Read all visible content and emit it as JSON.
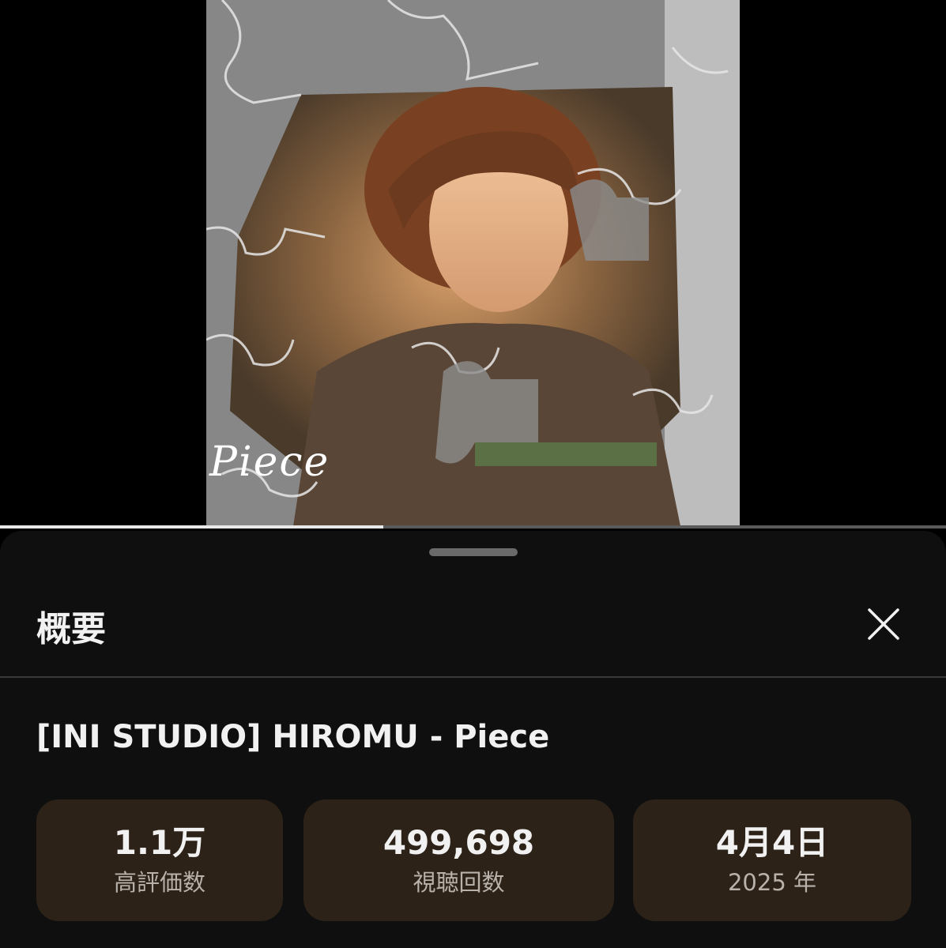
{
  "player": {
    "thumbnail_text": "Piece",
    "progress_fraction": 0.405
  },
  "sheet": {
    "title": "概要",
    "close_icon": "close-icon"
  },
  "video": {
    "title": "[INI STUDIO] HIROMU - Piece"
  },
  "stats": [
    {
      "value": "1.1万",
      "label": "高評価数"
    },
    {
      "value": "499,698",
      "label": "視聴回数"
    },
    {
      "value": "4月4日",
      "label": "2025 年"
    }
  ],
  "colors": {
    "sheet_bg": "#0f0f0f",
    "stat_card_bg": "#2c2218",
    "text_primary": "#f1f1f1",
    "text_secondary": "#b8b2ab"
  }
}
